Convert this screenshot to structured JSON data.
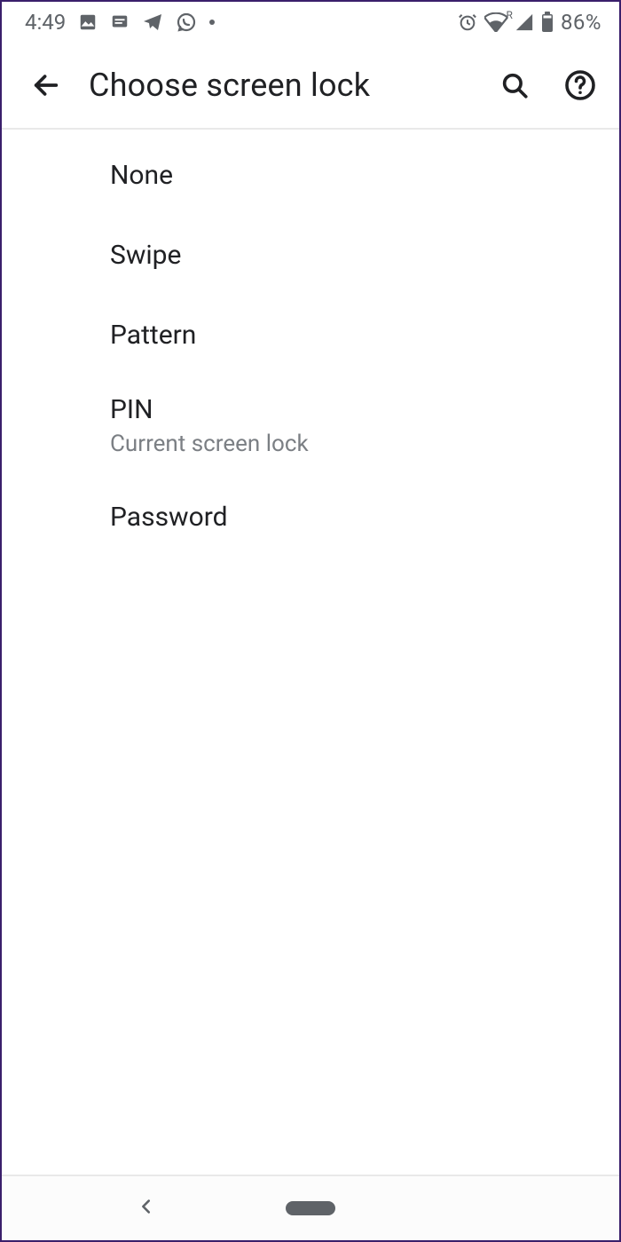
{
  "status": {
    "time": "4:49",
    "battery_pct": "86%"
  },
  "header": {
    "title": "Choose screen lock"
  },
  "options": [
    {
      "label": "None",
      "sub": ""
    },
    {
      "label": "Swipe",
      "sub": ""
    },
    {
      "label": "Pattern",
      "sub": ""
    },
    {
      "label": "PIN",
      "sub": "Current screen lock"
    },
    {
      "label": "Password",
      "sub": ""
    }
  ]
}
